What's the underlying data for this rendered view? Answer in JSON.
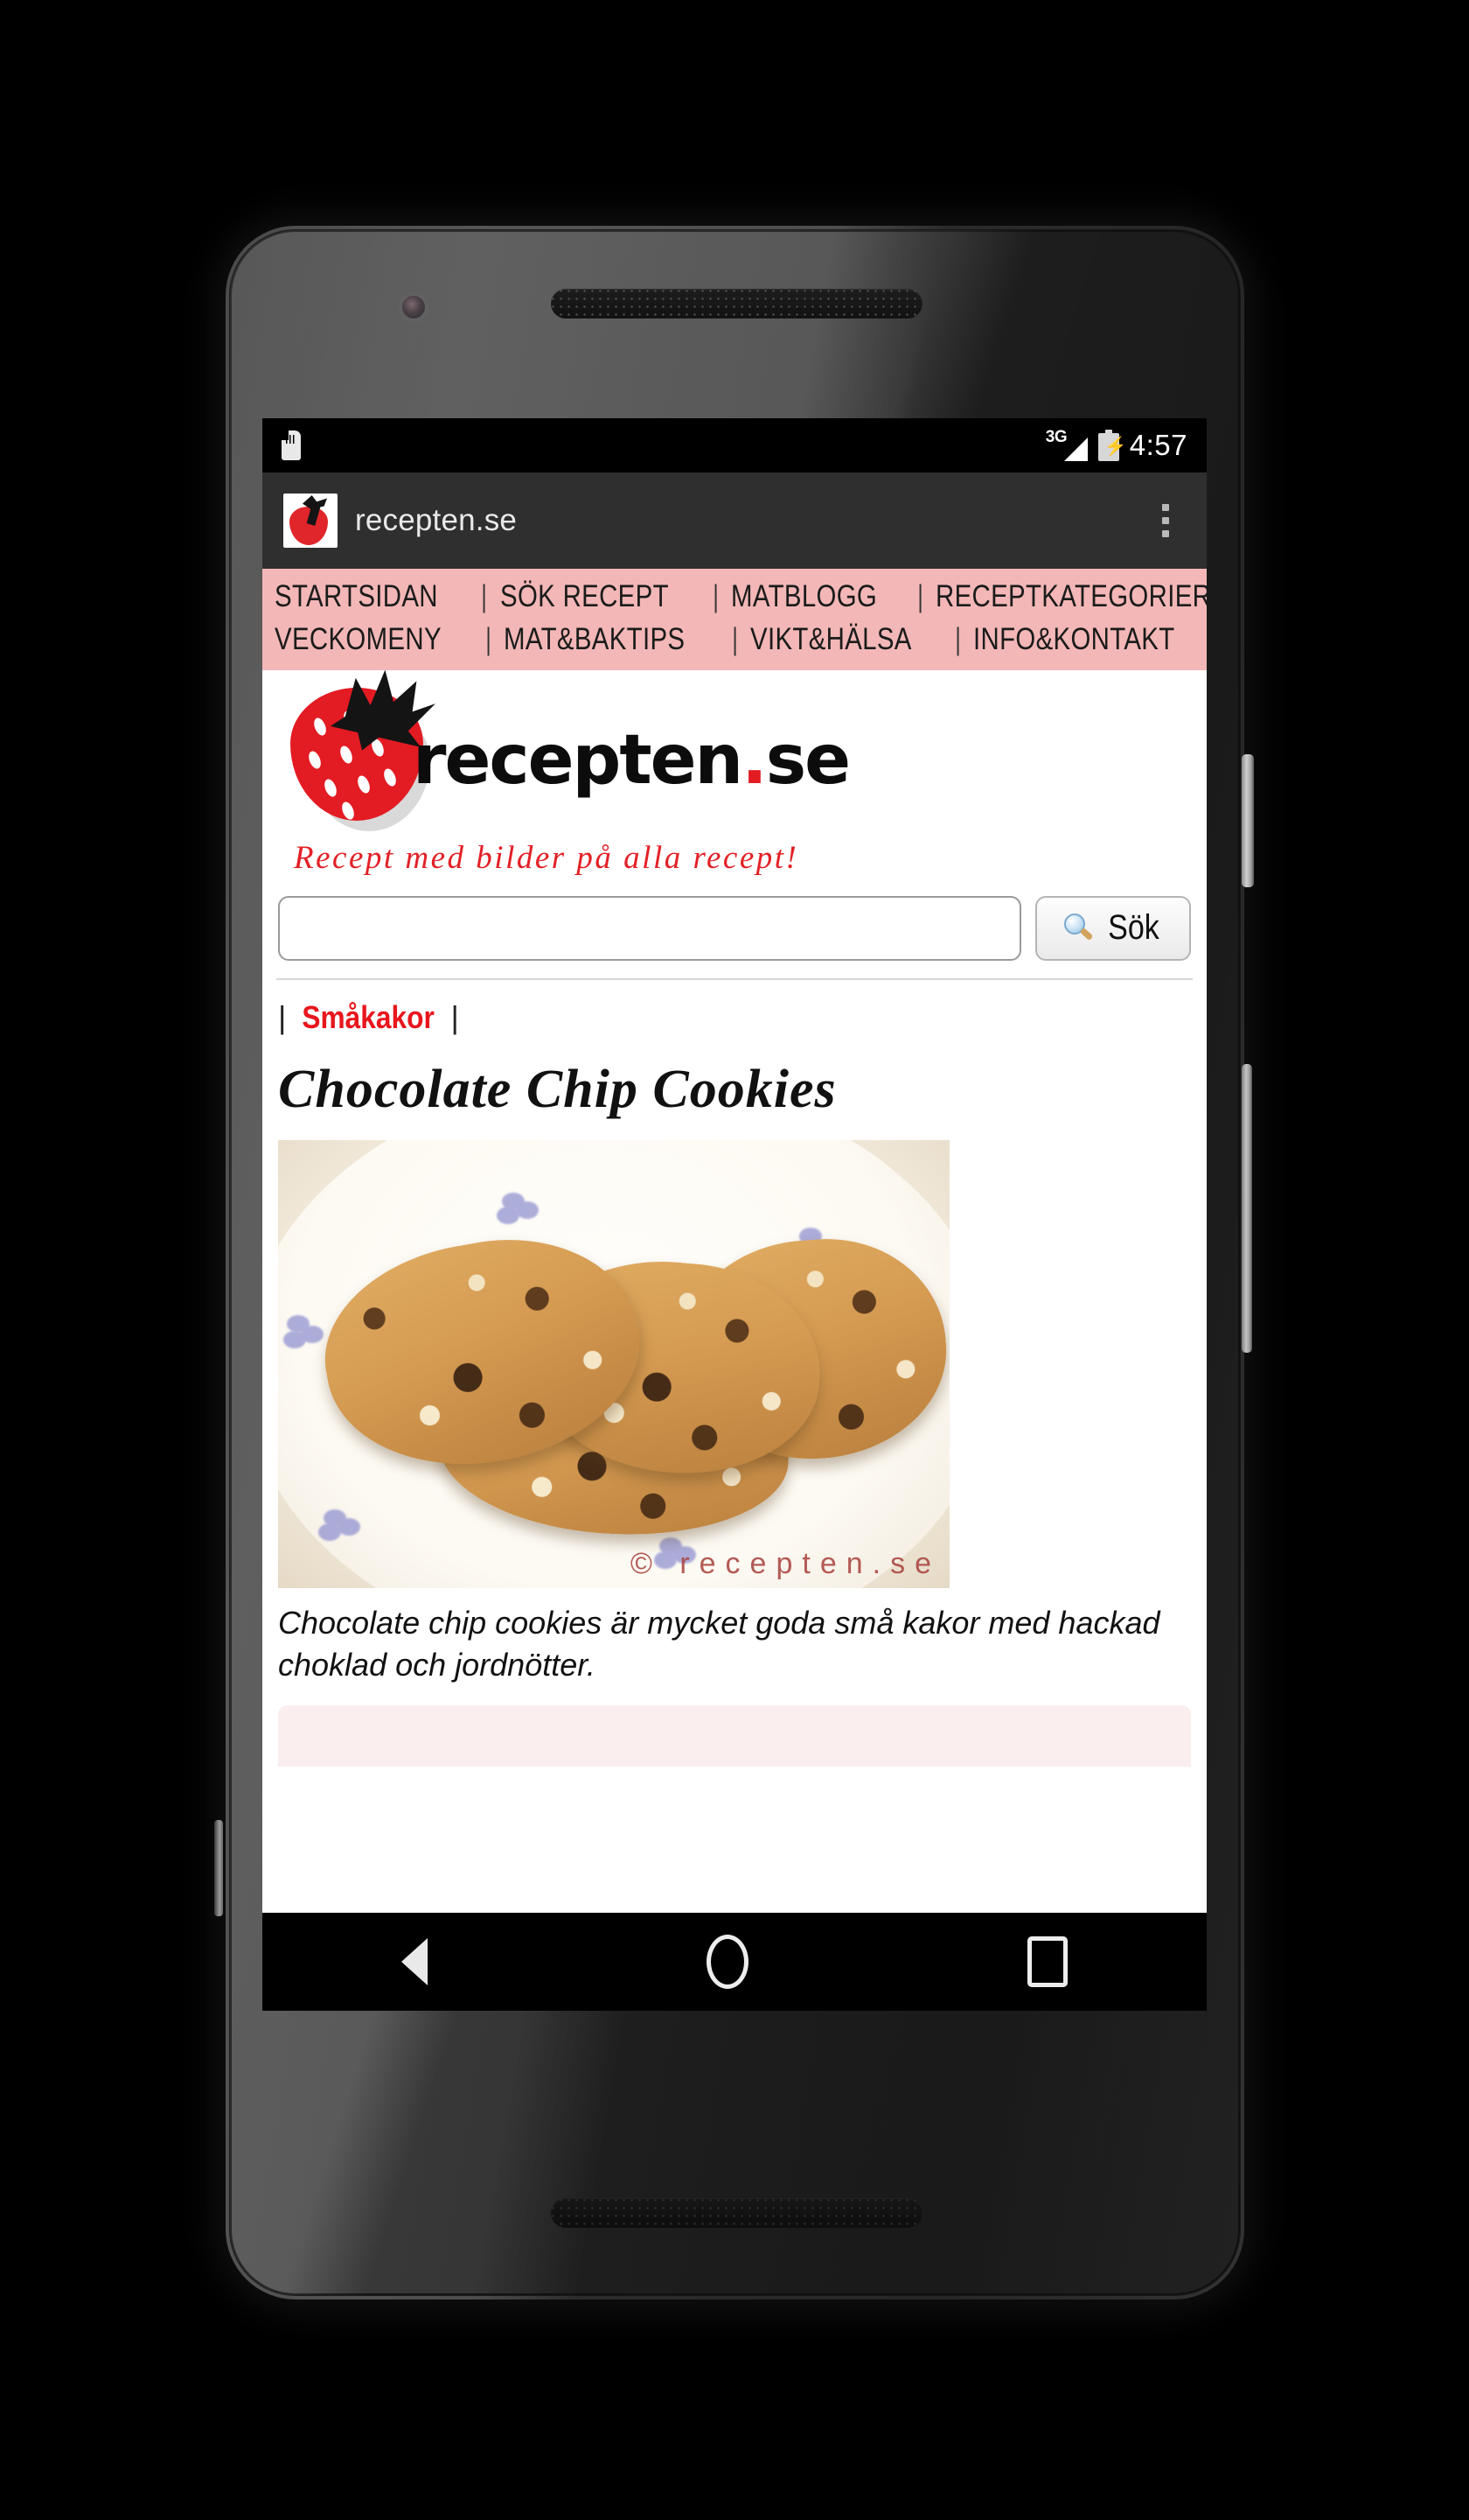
{
  "status_bar": {
    "sd_card_icon": "sd-card-icon",
    "network_label": "3G",
    "signal_icon": "signal-triangle-icon",
    "battery_icon": "battery-charging-icon",
    "time": "4:57"
  },
  "browser": {
    "favicon": "strawberry-favicon",
    "tab_title": "recepten.se",
    "overflow_menu_icon": "three-dot-menu-icon"
  },
  "site_nav": {
    "row1": [
      "STARTSIDAN",
      "SÖK RECEPT",
      "MATBLOGG",
      "RECEPTKATEGORIER"
    ],
    "row2": [
      "VECKOMENY",
      "MAT&BAKTIPS",
      "VIKT&HÄLSA",
      "INFO&KONTAKT"
    ],
    "separator": "|",
    "background_color": "#f3b7b7"
  },
  "branding": {
    "logo_icon": "strawberry-logo-icon",
    "logo_name": "recepten",
    "logo_dot": ".",
    "logo_tld": "se",
    "tagline": "Recept med bilder på alla recept!",
    "brand_red": "#e31b23"
  },
  "search": {
    "value": "",
    "placeholder": "",
    "button_label": "Sök",
    "button_icon": "magnifier-icon"
  },
  "breadcrumb": {
    "left_bar": "|",
    "category": "Småkakor",
    "right_bar": "|",
    "link_color": "#e8161d"
  },
  "recipe": {
    "title": "Chocolate Chip Cookies",
    "photo_alt": "chocolate-chip-cookies-on-plate",
    "photo_watermark": "© recepten.se",
    "description": "Chocolate chip cookies är mycket goda små kakor med hackad choklad och jordnötter."
  },
  "android_nav": {
    "back_icon": "back-triangle-icon",
    "home_icon": "home-circle-icon",
    "recents_icon": "recents-square-icon"
  },
  "hardware": {
    "front_camera": "front-camera",
    "earpiece": "earpiece-speaker",
    "bottom_speaker": "bottom-speaker",
    "power_button": "power-button",
    "volume_button": "volume-rocker"
  }
}
